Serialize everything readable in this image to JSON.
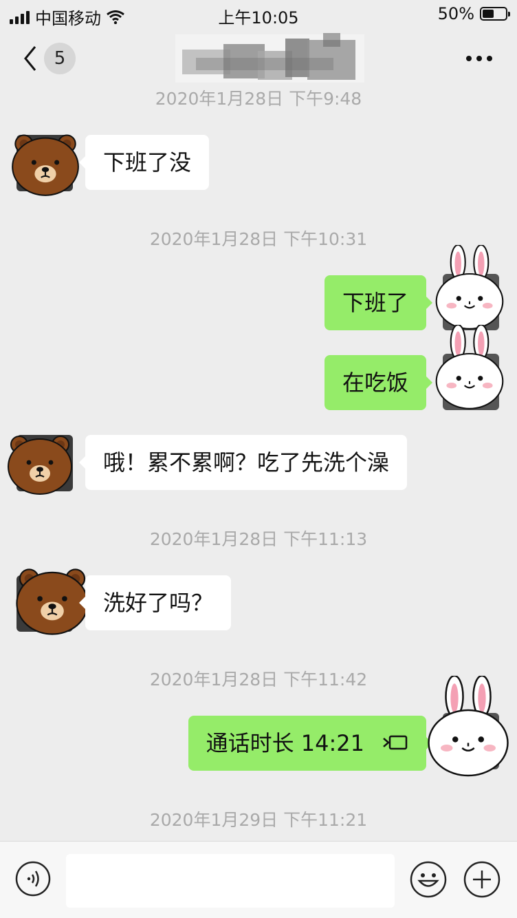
{
  "status_bar": {
    "carrier": "中国移动",
    "time": "上午10:05",
    "battery_text": "50%",
    "battery_level": 0.5
  },
  "nav": {
    "unread_count": "5",
    "title_obscured": true
  },
  "messages": [
    {
      "type": "timestamp",
      "text": "2020年1月28日 下午9:48"
    },
    {
      "type": "incoming",
      "text": "下班了没",
      "avatar": "brown-bear"
    },
    {
      "type": "timestamp",
      "text": "2020年1月28日 下午10:31"
    },
    {
      "type": "outgoing",
      "text": "下班了",
      "avatar": "white-rabbit"
    },
    {
      "type": "outgoing",
      "text": "在吃饭",
      "avatar": "white-rabbit"
    },
    {
      "type": "incoming",
      "text": "哦！累不累啊？吃了先洗个澡",
      "avatar": "brown-bear"
    },
    {
      "type": "timestamp",
      "text": "2020年1月28日 下午11:13"
    },
    {
      "type": "incoming",
      "text": "洗好了吗？",
      "avatar": "brown-bear"
    },
    {
      "type": "timestamp",
      "text": "2020年1月28日 下午11:42"
    },
    {
      "type": "outgoing",
      "text": "通话时长 14:21",
      "avatar": "white-rabbit",
      "icon": "call-icon"
    },
    {
      "type": "timestamp",
      "text": "2020年1月29日 下午11:21"
    }
  ],
  "input_bar": {
    "value": "",
    "icons": [
      "voice-icon",
      "emoji-icon",
      "plus-icon"
    ]
  },
  "colors": {
    "background": "#ededed",
    "outgoing_bubble": "#95ec69",
    "incoming_bubble": "#ffffff",
    "timestamp": "#a9a9a9"
  }
}
